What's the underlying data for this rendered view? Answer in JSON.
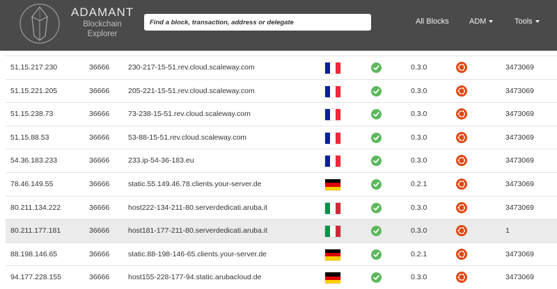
{
  "header": {
    "brand_title": "ADAMANT",
    "brand_subtitle": "Blockchain Explorer",
    "search_placeholder": "Find a block, transaction, address or delegate",
    "nav": {
      "all_blocks": "All Blocks",
      "adm": "ADM",
      "tools": "Tools"
    }
  },
  "colors": {
    "header_bg": "#4a4a4a",
    "status_ok": "#5cb85c",
    "os_icon": "#dd4814",
    "highlight_row": "#ebebeb"
  },
  "rows": [
    {
      "ip": "51.15.217.230",
      "port": "36666",
      "host": "230-217-15-51.rev.cloud.scaleway.com",
      "flag": "france-flag-icon",
      "status": "ok-icon",
      "version": "0.3.0",
      "os": "ubuntu-icon",
      "height": "3473069"
    },
    {
      "ip": "51.15.221.205",
      "port": "36666",
      "host": "205-221-15-51.rev.cloud.scaleway.com",
      "flag": "france-flag-icon",
      "status": "ok-icon",
      "version": "0.3.0",
      "os": "ubuntu-icon",
      "height": "3473069"
    },
    {
      "ip": "51.15.238.73",
      "port": "36666",
      "host": "73-238-15-51.rev.cloud.scaleway.com",
      "flag": "france-flag-icon",
      "status": "ok-icon",
      "version": "0.3.0",
      "os": "ubuntu-icon",
      "height": "3473069"
    },
    {
      "ip": "51.15.88.53",
      "port": "36666",
      "host": "53-88-15-51.rev.cloud.scaleway.com",
      "flag": "france-flag-icon",
      "status": "ok-icon",
      "version": "0.3.0",
      "os": "ubuntu-icon",
      "height": "3473069"
    },
    {
      "ip": "54.36.183.233",
      "port": "36666",
      "host": "233.ip-54-36-183.eu",
      "flag": "france-flag-icon",
      "status": "ok-icon",
      "version": "0.3.0",
      "os": "ubuntu-icon",
      "height": "3473069"
    },
    {
      "ip": "78.46.149.55",
      "port": "36666",
      "host": "static.55.149.46.78.clients.your-server.de",
      "flag": "germany-flag-icon",
      "status": "ok-icon",
      "version": "0.2.1",
      "os": "ubuntu-icon",
      "height": "3473069"
    },
    {
      "ip": "80.211.134.222",
      "port": "36666",
      "host": "host222-134-211-80.serverdedicati.aruba.it",
      "flag": "italy-flag-icon",
      "status": "ok-icon",
      "version": "0.3.0",
      "os": "ubuntu-icon",
      "height": "3473069"
    },
    {
      "ip": "80.211.177.181",
      "port": "36666",
      "host": "host181-177-211-80.serverdedicati.aruba.it",
      "flag": "italy-flag-icon",
      "status": "ok-icon",
      "version": "0.3.0",
      "os": "ubuntu-icon",
      "height": "1",
      "highlight": true
    },
    {
      "ip": "88.198.146.65",
      "port": "36666",
      "host": "static.88-198-146-65.clients.your-server.de",
      "flag": "germany-flag-icon",
      "status": "ok-icon",
      "version": "0.2.1",
      "os": "ubuntu-icon",
      "height": "3473069"
    },
    {
      "ip": "94.177.228.155",
      "port": "36666",
      "host": "host155-228-177-94.static.arubacloud.de",
      "flag": "germany-flag-icon",
      "status": "ok-icon",
      "version": "0.3.0",
      "os": "ubuntu-icon",
      "height": "3473069"
    }
  ]
}
